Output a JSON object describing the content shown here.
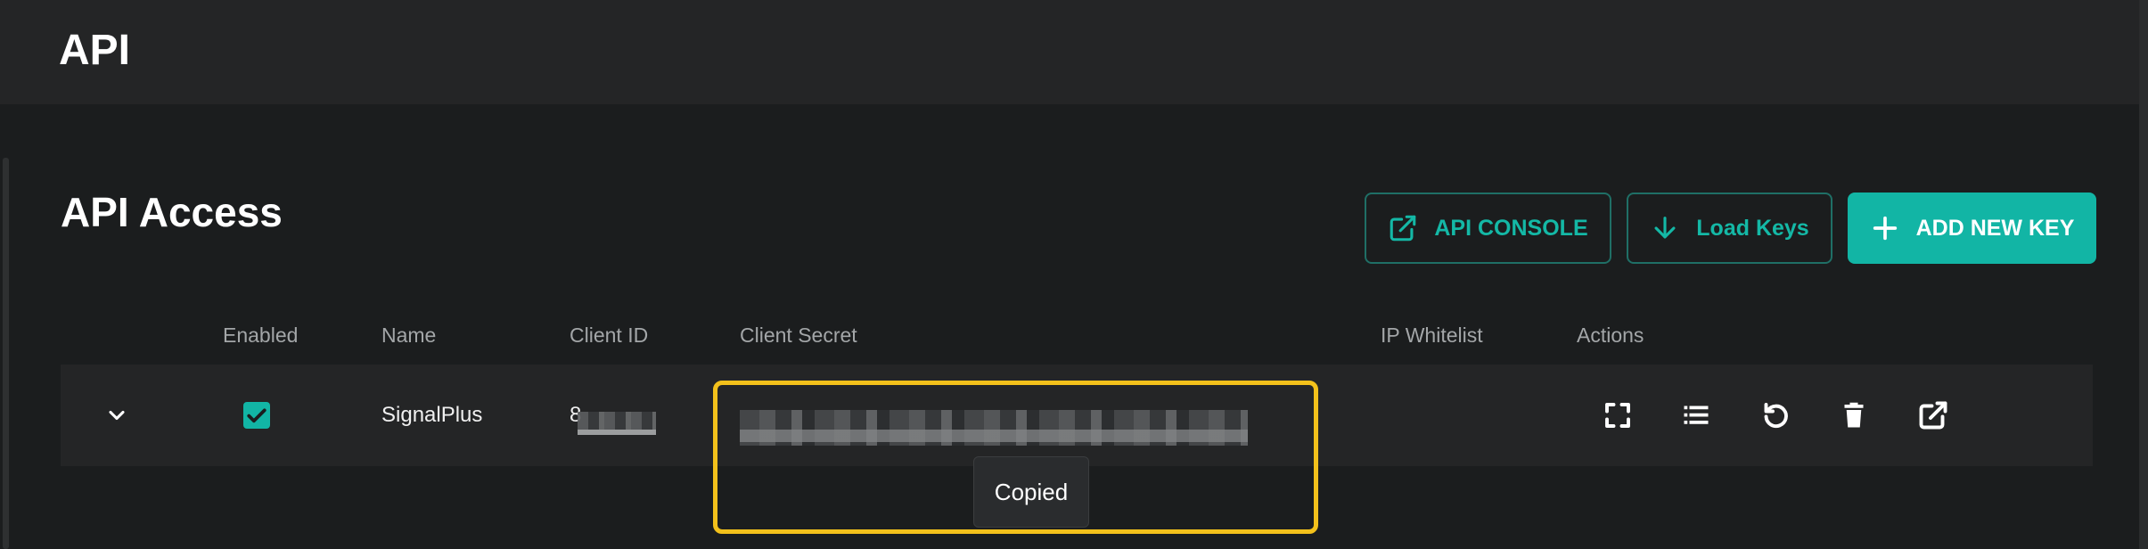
{
  "header": {
    "title": "API"
  },
  "page": {
    "section_title": "API Access",
    "buttons": {
      "console": "API CONSOLE",
      "load": "Load Keys",
      "add": "ADD NEW KEY"
    }
  },
  "table": {
    "columns": [
      "Enabled",
      "Name",
      "Client ID",
      "Client Secret",
      "IP Whitelist",
      "Actions"
    ],
    "rows": [
      {
        "enabled": true,
        "name": "SignalPlus",
        "client_id_visible": "8",
        "ip_whitelist": "",
        "action_icons": [
          "expand-icon",
          "list-icon",
          "refresh-icon",
          "trash-icon",
          "open-external-icon"
        ]
      }
    ]
  },
  "tooltip": {
    "text": "Copied"
  },
  "colors": {
    "accent": "#12b5a5",
    "highlight": "#f3c11b",
    "background": "#1b1d1e"
  }
}
